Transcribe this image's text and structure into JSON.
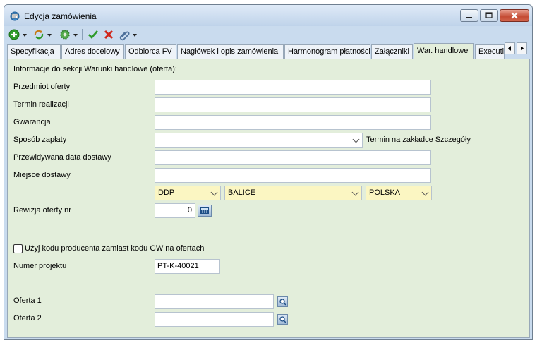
{
  "window": {
    "title": "Edycja zamówienia",
    "icon": "order-edit-icon",
    "controls": [
      "minimize-icon",
      "maximize-icon",
      "close-icon"
    ]
  },
  "toolbar": {
    "items": [
      "add-icon",
      "refresh-icon",
      "settings-icon",
      "accept-icon",
      "cancel-icon",
      "attach-icon"
    ],
    "colors": {
      "accept": "#2e9a2a",
      "cancel": "#d0281c",
      "add": "#2e9a2a"
    }
  },
  "tabs": {
    "items": [
      {
        "label": "Specyfikacja"
      },
      {
        "label": "Adres docelowy"
      },
      {
        "label": "Odbiorca FV"
      },
      {
        "label": "Nagłówek i opis zamówienia"
      },
      {
        "label": "Harmonogram płatności"
      },
      {
        "label": "Załączniki"
      },
      {
        "label": "War. handlowe"
      },
      {
        "label": "Executi"
      }
    ],
    "active": "War. handlowe"
  },
  "form": {
    "section_header": "Informacje do sekcji Warunki handlowe (oferta):",
    "subject_label": "Przedmiot oferty",
    "subject_value": "",
    "lead_time_label": "Termin realizacji",
    "lead_time_value": "",
    "warranty_label": "Gwarancja",
    "warranty_value": "",
    "payment_label": "Sposób zapłaty",
    "payment_value": "",
    "payment_note": "Termin na zakładce Szczegóły",
    "delivery_date_label": "Przewidywana data dostawy",
    "delivery_date_value": "",
    "delivery_place_label": "Miejsce dostawy",
    "delivery_place_value": "",
    "incoterm_value": "DDP",
    "city_value": "BALICE",
    "country_value": "POLSKA",
    "revision_label": "Rewizja oferty nr",
    "revision_value": "0",
    "use_producer_code_label": "Użyj kodu producenta zamiast kodu GW na ofertach",
    "use_producer_code_checked": false,
    "project_label": "Numer projektu",
    "project_value": "PT-K-40021",
    "offer1_label": "Oferta 1",
    "offer1_value": "",
    "offer2_label": "Oferta 2",
    "offer2_value": ""
  }
}
